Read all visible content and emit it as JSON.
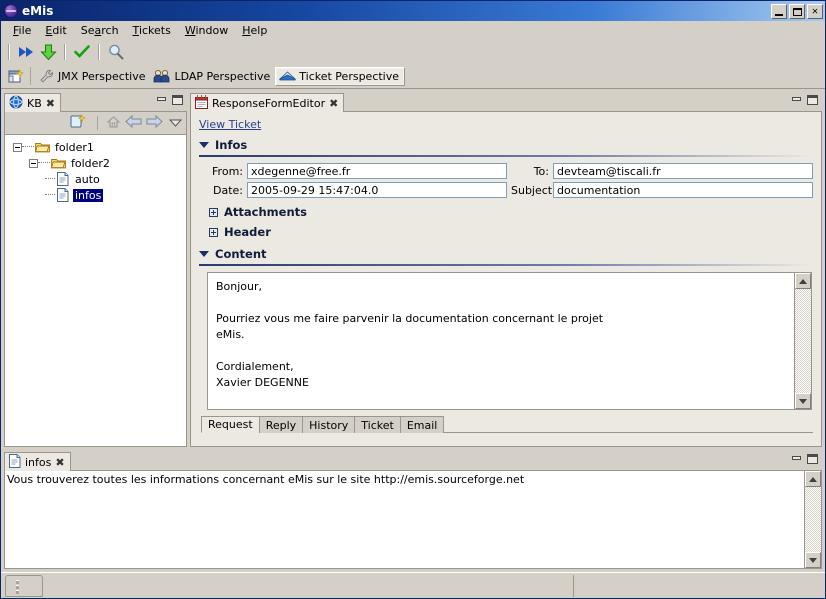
{
  "window": {
    "title": "eMis",
    "icon": "globe-icon",
    "buttons": {
      "minimize": "minimize",
      "maximize": "maximize",
      "close": "close"
    }
  },
  "menubar": {
    "items": [
      {
        "label": "File",
        "mnemonic": "F"
      },
      {
        "label": "Edit",
        "mnemonic": "E"
      },
      {
        "label": "Search",
        "mnemonic": "a"
      },
      {
        "label": "Tickets",
        "mnemonic": "T"
      },
      {
        "label": "Window",
        "mnemonic": "W"
      },
      {
        "label": "Help",
        "mnemonic": "H"
      }
    ]
  },
  "toolbar": {
    "buttons": [
      {
        "name": "fast-forward-icon",
        "glyph": "▶▶",
        "color": "#1a56c4"
      },
      {
        "name": "download-arrow-icon",
        "glyph": "⬇",
        "color": "#49b832"
      },
      {
        "name": "check-icon",
        "glyph": "✔",
        "color": "#1f9b1f"
      },
      {
        "name": "search-magnifier-icon",
        "glyph": "ὐD",
        "color": "#6d8ca8"
      }
    ]
  },
  "perspectives": {
    "new_button_label": "",
    "tabs": [
      {
        "label": "JMX Perspective",
        "icon": "wrench-icon",
        "active": false
      },
      {
        "label": "LDAP Perspective",
        "icon": "users-icon",
        "active": false
      },
      {
        "label": "Ticket Perspective",
        "icon": "envelope-icon",
        "active": true
      }
    ]
  },
  "kb_view": {
    "tab_label": "KB",
    "tab_icon": "globe-icon",
    "close_glyph": "✖",
    "toolbar": [
      {
        "name": "new-note-icon"
      },
      {
        "name": "home-icon"
      },
      {
        "name": "back-arrow-icon"
      },
      {
        "name": "forward-arrow-icon"
      },
      {
        "name": "view-menu-chevron-icon"
      }
    ],
    "tree": [
      {
        "label": "folder1",
        "type": "folder",
        "depth": 0,
        "expanded": true,
        "selected": false
      },
      {
        "label": "folder2",
        "type": "folder",
        "depth": 1,
        "expanded": true,
        "selected": false
      },
      {
        "label": "auto",
        "type": "file",
        "depth": 2,
        "expanded": null,
        "selected": false
      },
      {
        "label": "infos",
        "type": "file",
        "depth": 2,
        "expanded": null,
        "selected": true
      }
    ],
    "min_tooltip": "Minimize",
    "max_tooltip": "Maximize"
  },
  "editor": {
    "tab_label": "ResponseFormEditor",
    "tab_icon": "form-icon",
    "close_glyph": "✖",
    "link": "View Ticket",
    "sections": [
      {
        "id": "infos",
        "title": "Infos",
        "expanded": true
      },
      {
        "id": "attachments",
        "title": "Attachments",
        "expanded": false
      },
      {
        "id": "header",
        "title": "Header",
        "expanded": false
      },
      {
        "id": "content",
        "title": "Content",
        "expanded": true
      }
    ],
    "fields": {
      "from_label": "From:",
      "from_value": "xdegenne@free.fr",
      "to_label": "To:",
      "to_value": "devteam@tiscali.fr",
      "date_label": "Date:",
      "date_value": "2005-09-29 15:47:04.0",
      "subject_label": "Subject:",
      "subject_value": "documentation"
    },
    "content_body": "Bonjour,\n\nPourriez vous me faire parvenir la documentation concernant le projet\neMis.\n\nCordialement,\nXavier DEGENNE",
    "bottom_tabs": [
      {
        "label": "Request",
        "active": true
      },
      {
        "label": "Reply",
        "active": false
      },
      {
        "label": "History",
        "active": false
      },
      {
        "label": "Ticket",
        "active": false
      },
      {
        "label": "Email",
        "active": false
      }
    ]
  },
  "infos_view": {
    "tab_label": "infos",
    "tab_icon": "document-icon",
    "close_glyph": "✖",
    "text": "Vous trouverez toutes les informations concernant eMis sur le site http://emis.sourceforge.net"
  },
  "statusbar": {
    "left_text": "",
    "right_text": ""
  },
  "colors": {
    "title_start": "#0a246a",
    "title_end": "#a6caf0",
    "chrome": "#d4d0c8",
    "panel": "#ece9e2",
    "accent": "#24366e",
    "selection": "#000080",
    "link": "#2a3f8f"
  }
}
